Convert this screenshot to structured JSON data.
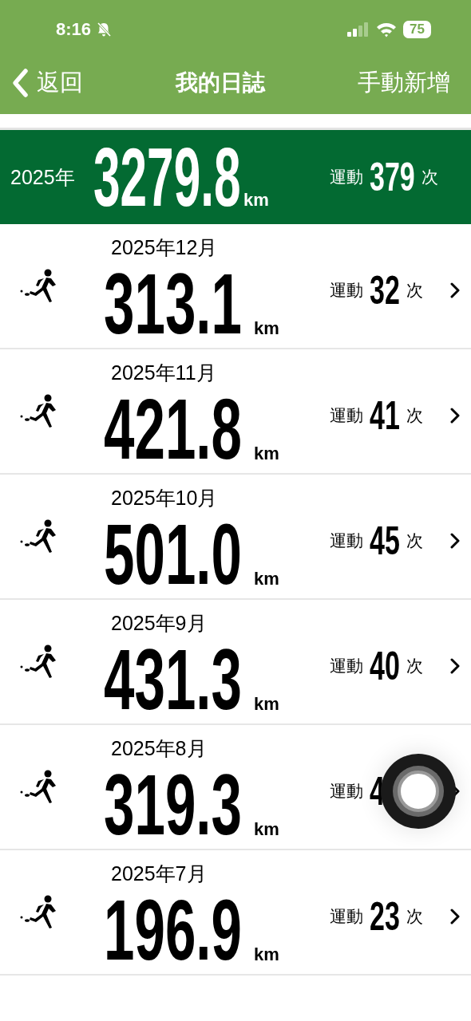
{
  "status_bar": {
    "time": "8:16",
    "battery": "75"
  },
  "nav": {
    "back": "返回",
    "title": "我的日誌",
    "action": "手動新增"
  },
  "summary": {
    "year": "2025年",
    "distance": "3279.8",
    "unit": "km",
    "count_label": "運動",
    "count": "379",
    "count_unit": "次"
  },
  "months": [
    {
      "month": "2025年12月",
      "distance": "313.1",
      "unit": "km",
      "count_label": "運動",
      "count": "32",
      "count_unit": "次"
    },
    {
      "month": "2025年11月",
      "distance": "421.8",
      "unit": "km",
      "count_label": "運動",
      "count": "41",
      "count_unit": "次"
    },
    {
      "month": "2025年10月",
      "distance": "501.0",
      "unit": "km",
      "count_label": "運動",
      "count": "45",
      "count_unit": "次"
    },
    {
      "month": "2025年9月",
      "distance": "431.3",
      "unit": "km",
      "count_label": "運動",
      "count": "40",
      "count_unit": "次"
    },
    {
      "month": "2025年8月",
      "distance": "319.3",
      "unit": "km",
      "count_label": "運動",
      "count": "4"
    },
    {
      "month": "2025年7月",
      "distance": "196.9",
      "unit": "km",
      "count_label": "運動",
      "count": "23",
      "count_unit": "次"
    }
  ]
}
